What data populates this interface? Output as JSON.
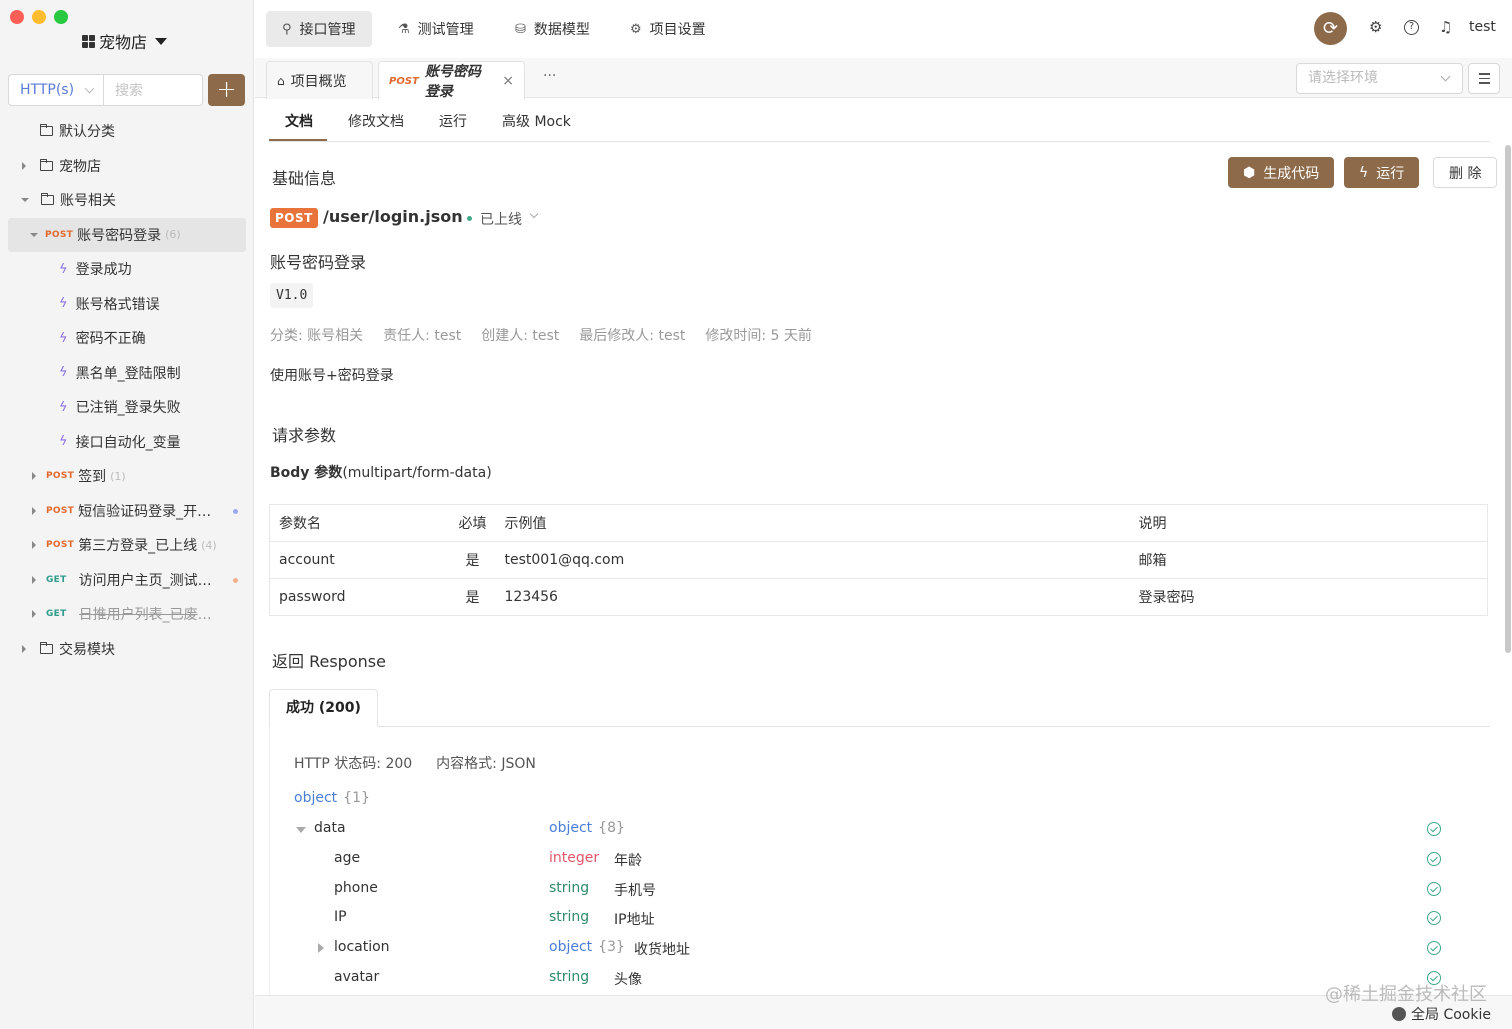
{
  "sidebar": {
    "project_name": "宠物店",
    "protocol_select": "HTTP(s)",
    "search_placeholder": "搜索",
    "add_label": "+",
    "tree": {
      "default_folder": "默认分类",
      "petshop_folder": "宠物店",
      "account_folder": "账号相关",
      "active_api": {
        "method": "POST",
        "name": "账号密码登录",
        "count": "(6)"
      },
      "cases": [
        "登录成功",
        "账号格式错误",
        "密码不正确",
        "黑名单_登陆限制",
        "已注销_登录失败",
        "接口自动化_变量"
      ],
      "apis": [
        {
          "method": "POST",
          "name": "签到",
          "count": "(1)"
        },
        {
          "method": "POST",
          "name": "短信验证码登录_开发..."
        },
        {
          "method": "POST",
          "name": "第三方登录_已上线",
          "count": "(4)"
        },
        {
          "method": "GET",
          "name": "访问用户主页_测试中..."
        },
        {
          "method": "GET",
          "name": "日推用户列表_已废弃..."
        }
      ],
      "trade_folder": "交易模块"
    }
  },
  "topbar": {
    "tabs": [
      "接口管理",
      "测试管理",
      "数据模型",
      "项目设置"
    ],
    "user": "test"
  },
  "doctabs": {
    "overview": "项目概览",
    "active_method": "POST",
    "active_title": "账号密码登录",
    "more": "···",
    "env_placeholder": "请选择环境"
  },
  "subtabs": [
    "文档",
    "修改文档",
    "运行",
    "高级 Mock"
  ],
  "basic": {
    "title": "基础信息",
    "gen_code": "生成代码",
    "run": "运行",
    "delete": "删 除",
    "method": "POST",
    "path": "/user/login.json",
    "status": "已上线",
    "name": "账号密码登录",
    "version": "V1.0",
    "meta": [
      "分类: 账号相关",
      "责任人: test",
      "创建人: test",
      "最后修改人: test",
      "修改时间: 5 天前"
    ],
    "description": "使用账号+密码登录"
  },
  "request": {
    "title": "请求参数",
    "body_label": "Body 参数",
    "body_format": "(multipart/form-data)",
    "headers": [
      "参数名",
      "必填",
      "示例值",
      "说明"
    ],
    "rows": [
      [
        "account",
        "是",
        "test001@qq.com",
        "邮箱"
      ],
      [
        "password",
        "是",
        "123456",
        "登录密码"
      ]
    ]
  },
  "response": {
    "title": "返回 Response",
    "tab": "成功 (200)",
    "http_status": "HTTP 状态码: 200",
    "content_type": "内容格式: JSON",
    "root_type": "object",
    "root_count": "{1}",
    "fields": [
      {
        "name": "data",
        "type": "object",
        "extra": "{8}",
        "desc": ""
      },
      {
        "name": "age",
        "type": "integer",
        "extra": "",
        "desc": "年龄"
      },
      {
        "name": "phone",
        "type": "string",
        "extra": "",
        "desc": "手机号"
      },
      {
        "name": "IP",
        "type": "string",
        "extra": "",
        "desc": "IP地址"
      },
      {
        "name": "location",
        "type": "object",
        "extra": "{3}",
        "desc": "收货地址"
      },
      {
        "name": "avatar",
        "type": "string",
        "extra": "",
        "desc": "头像"
      }
    ]
  },
  "bottombar": {
    "watermark": "@稀土掘金技术社区",
    "cookie": "全局 Cookie"
  },
  "colors": {
    "brand": "#8c6a4a",
    "post": "#e8743b",
    "get": "#2d9c8b",
    "object_type": "#4a7ed6",
    "integer_type": "#e0566b",
    "string_type": "#2f8a6b"
  }
}
